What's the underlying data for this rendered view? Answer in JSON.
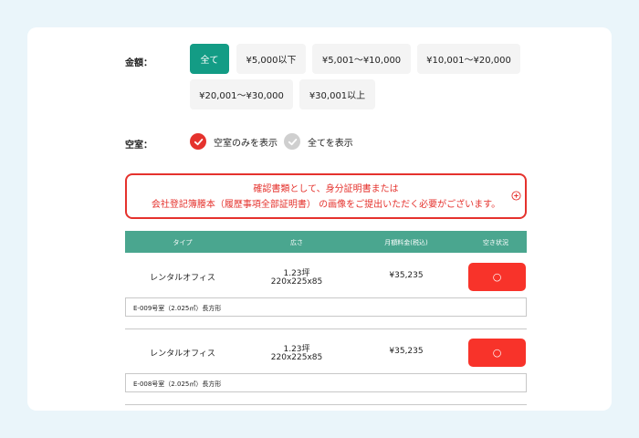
{
  "filters": {
    "price_label": "金額：",
    "price_options": [
      {
        "label": "全て",
        "active": true
      },
      {
        "label": "¥5,000以下",
        "active": false
      },
      {
        "label": "¥5,001〜¥10,000",
        "active": false
      },
      {
        "label": "¥10,001〜¥20,000",
        "active": false
      },
      {
        "label": "¥20,001〜¥30,000",
        "active": false
      },
      {
        "label": "¥30,001以上",
        "active": false
      }
    ],
    "vacancy_label": "空室：",
    "vacancy_options": [
      {
        "label": "空室のみを表示",
        "selected": true
      },
      {
        "label": "全てを表示",
        "selected": false
      }
    ]
  },
  "notice": {
    "line1": "確認書類として、身分証明書または",
    "line2": "会社登記簿謄本（履歴事項全部証明書） の画像をご提出いただく必要がございます。"
  },
  "table": {
    "headers": [
      "タイプ",
      "広さ",
      "月額料金(税込)",
      "空き状況"
    ],
    "rows": [
      {
        "type": "レンタルオフィス",
        "size_tsubo": "1.23坪",
        "size_dims": "220x225x85",
        "price": "¥35,235",
        "status": "○",
        "note": "E-009号室（2.025㎡）長方形"
      },
      {
        "type": "レンタルオフィス",
        "size_tsubo": "1.23坪",
        "size_dims": "220x225x85",
        "price": "¥35,235",
        "status": "○",
        "note": "E-008号室（2.025㎡）長方形"
      }
    ]
  },
  "colors": {
    "accent": "#139c85",
    "table_header": "#4aa68f",
    "alert": "#e5322d",
    "status_button": "#f8332a"
  }
}
